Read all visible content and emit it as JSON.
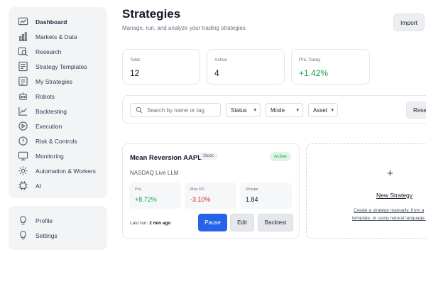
{
  "sidebar": {
    "items": [
      {
        "label": "Dashboard",
        "icon": "dashboard-icon"
      },
      {
        "label": "Markets & Data",
        "icon": "markets-icon"
      },
      {
        "label": "Research",
        "icon": "research-icon"
      },
      {
        "label": "Strategy Templates",
        "icon": "templates-icon"
      },
      {
        "label": "My Strategies",
        "icon": "strategies-icon"
      },
      {
        "label": "Robots",
        "icon": "robot-icon"
      },
      {
        "label": "Backtesting",
        "icon": "backtest-icon"
      },
      {
        "label": "Execution",
        "icon": "execution-icon"
      },
      {
        "label": "Risk & Controls",
        "icon": "risk-icon"
      },
      {
        "label": "Monitoring",
        "icon": "monitor-icon"
      },
      {
        "label": "Automation & Workers",
        "icon": "automation-icon"
      },
      {
        "label": "AI",
        "icon": "ai-icon"
      }
    ],
    "bottom_items": [
      {
        "label": "Profile",
        "icon": "lightbulb-icon"
      },
      {
        "label": "Settings",
        "icon": "lightbulb-icon"
      }
    ]
  },
  "header": {
    "title": "Strategies",
    "subtitle": "Manage, run, and analyze your trading strategies",
    "import_label": "Import"
  },
  "stats": [
    {
      "label": "Total",
      "value": "12"
    },
    {
      "label": "Active",
      "value": "4"
    },
    {
      "label": "PnL Today",
      "value": "+1.42%"
    }
  ],
  "filters": {
    "search_placeholder": "Search by name or tag",
    "status_label": "Status",
    "mode_label": "Mode",
    "asset_label": "Asset",
    "reset_label": "Reset"
  },
  "strategy_card": {
    "name": "Mean Reversion AAPL",
    "asset_tag": "Stock",
    "status": "Active",
    "meta": "NASDAQ  Live  LLM",
    "metrics": [
      {
        "label": "PnL",
        "value": "+8.72%"
      },
      {
        "label": "Max DD",
        "value": "-3.10%"
      },
      {
        "label": "Sharpe",
        "value": "1.84"
      }
    ],
    "last_run_label": "Last run:",
    "last_run_value": "2 min ago",
    "pause_label": "Pause",
    "edit_label": "Edit",
    "backtest_label": "Backtest"
  },
  "new_strategy": {
    "plus": "+",
    "title": "New Strategy",
    "desc_line1": "Create a strategy manually, from a",
    "desc_line2": "template, or using natural language."
  },
  "colors": {
    "accent": "#2563eb",
    "positive": "#16a34a",
    "negative": "#dc2626",
    "active_badge_bg": "#dcf5e4"
  }
}
